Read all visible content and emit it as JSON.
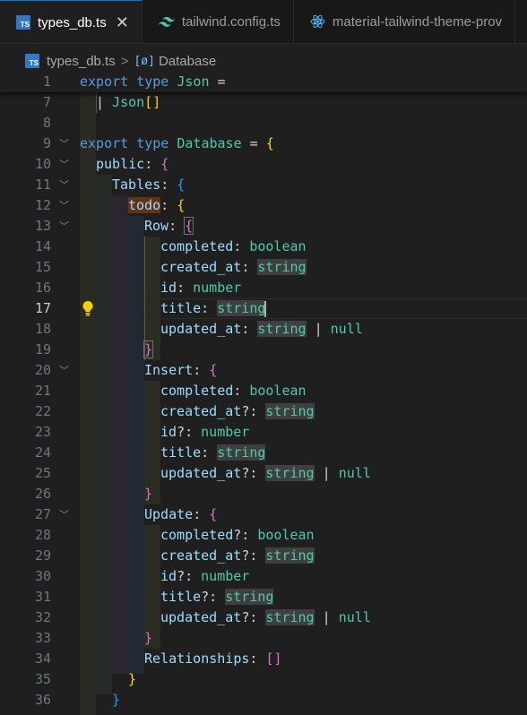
{
  "tabs": [
    {
      "label": "types_db.ts",
      "icon": "typescript-icon",
      "active": true
    },
    {
      "label": "tailwind.config.ts",
      "icon": "tailwind-icon",
      "active": false
    },
    {
      "label": "material-tailwind-theme-prov",
      "icon": "react-icon",
      "active": false
    }
  ],
  "ts_badge": "TS",
  "close_glyph": "✕",
  "breadcrumb": {
    "file": "types_db.ts",
    "symbol": "Database",
    "symbol_glyph": "[ø]",
    "separator": ">"
  },
  "colors": {
    "keyword": "#569cd6",
    "type": "#4ec9b0",
    "property": "#9cdcfe",
    "bracket_gold": "#ffd700",
    "bracket_purple": "#da70d6",
    "bracket_blue": "#179fff"
  },
  "editor": {
    "current_line": "17",
    "lines": [
      {
        "n": "1",
        "text": "export type Json ="
      },
      {
        "n": "7",
        "text": "| Json[]"
      },
      {
        "n": "8",
        "text": ""
      },
      {
        "n": "9",
        "text": "export type Database = {"
      },
      {
        "n": "10",
        "text": "public: {"
      },
      {
        "n": "11",
        "text": "Tables: {"
      },
      {
        "n": "12",
        "text": "todo: {"
      },
      {
        "n": "13",
        "text": "Row: {"
      },
      {
        "n": "14",
        "text": "completed: boolean"
      },
      {
        "n": "15",
        "text": "created_at: string"
      },
      {
        "n": "16",
        "text": "id: number"
      },
      {
        "n": "17",
        "text": "title: string"
      },
      {
        "n": "18",
        "text": "updated_at: string | null"
      },
      {
        "n": "19",
        "text": "}"
      },
      {
        "n": "20",
        "text": "Insert: {"
      },
      {
        "n": "21",
        "text": "completed: boolean"
      },
      {
        "n": "22",
        "text": "created_at?: string"
      },
      {
        "n": "23",
        "text": "id?: number"
      },
      {
        "n": "24",
        "text": "title: string"
      },
      {
        "n": "25",
        "text": "updated_at?: string | null"
      },
      {
        "n": "26",
        "text": "}"
      },
      {
        "n": "27",
        "text": "Update: {"
      },
      {
        "n": "28",
        "text": "completed?: boolean"
      },
      {
        "n": "29",
        "text": "created_at?: string"
      },
      {
        "n": "30",
        "text": "id?: number"
      },
      {
        "n": "31",
        "text": "title?: string"
      },
      {
        "n": "32",
        "text": "updated_at?: string | null"
      },
      {
        "n": "33",
        "text": "}"
      },
      {
        "n": "34",
        "text": "Relationships: []"
      },
      {
        "n": "35",
        "text": "}"
      },
      {
        "n": "36",
        "text": "}"
      }
    ]
  }
}
